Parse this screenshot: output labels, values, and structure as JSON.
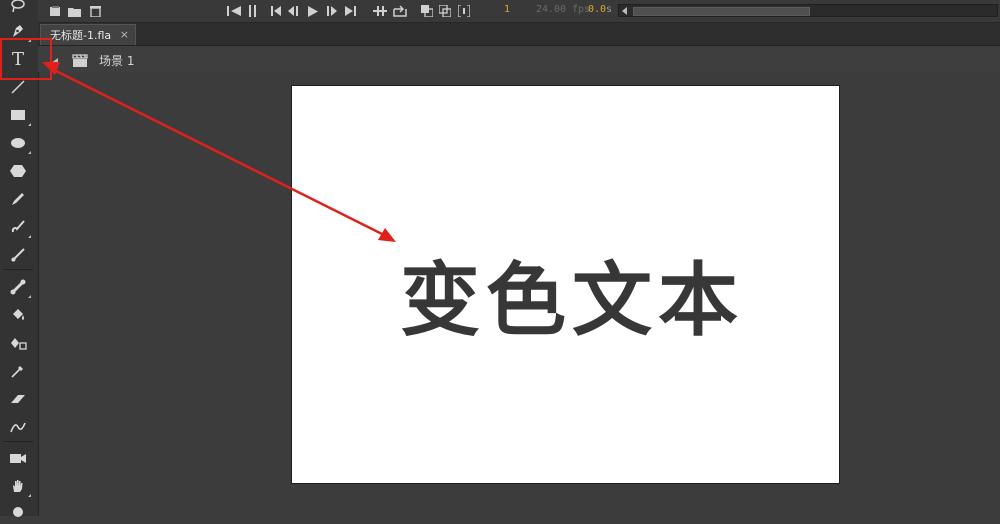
{
  "app": {
    "accent_color": "#e0201a",
    "stage_color": "#ffffff",
    "bg_color": "#3c3c3c"
  },
  "timeline": {
    "buttons": [
      "new-layer-icon",
      "new-folder-icon",
      "delete-layer-icon",
      "go-to-first-frame-icon",
      "pause-icon",
      "step-back-icon",
      "step-back-frame-icon",
      "play-icon",
      "step-forward-frame-icon",
      "go-to-last-frame-icon",
      "loop-icon",
      "onion-skin-icon",
      "onion-outline-icon",
      "edit-multiple-frames-icon",
      "modify-markers-icon"
    ],
    "current_frame": "1",
    "frame_rate": "24.00",
    "frame_rate_unit": "fps",
    "elapsed_time": "0.0",
    "elapsed_unit": "s"
  },
  "document": {
    "tab_label": "无标题-1.fla",
    "tab_close": "×"
  },
  "scene": {
    "label": "场景 1"
  },
  "stage": {
    "text": "变色文本"
  },
  "tools": [
    {
      "name": "lasso-icon",
      "glyph": "◌"
    },
    {
      "name": "pen-icon",
      "glyph": "✒"
    },
    {
      "name": "text-tool-icon",
      "glyph": "T"
    },
    {
      "name": "line-tool-icon",
      "glyph": "╱"
    },
    {
      "name": "rectangle-tool-icon",
      "glyph": "▬"
    },
    {
      "name": "oval-tool-icon",
      "glyph": "⬬"
    },
    {
      "name": "polystar-tool-icon",
      "glyph": "⬢"
    },
    {
      "name": "pencil-tool-icon",
      "glyph": "✎"
    },
    {
      "name": "paint-brush-icon",
      "glyph": "⌇"
    },
    {
      "name": "brush-tool-icon",
      "glyph": "⟋"
    },
    {
      "name": "bone-tool-icon",
      "glyph": "⚒"
    },
    {
      "name": "paint-bucket-icon",
      "glyph": "⛾"
    },
    {
      "name": "ink-bottle-icon",
      "glyph": "⛽"
    },
    {
      "name": "eyedropper-icon",
      "glyph": "⁄"
    },
    {
      "name": "eraser-icon",
      "glyph": "▰"
    },
    {
      "name": "width-tool-icon",
      "glyph": "⚕"
    },
    {
      "name": "camera-tool-icon",
      "glyph": "■"
    },
    {
      "name": "hand-tool-icon",
      "glyph": "✋"
    },
    {
      "name": "zoom-tool-icon",
      "glyph": "●"
    }
  ]
}
